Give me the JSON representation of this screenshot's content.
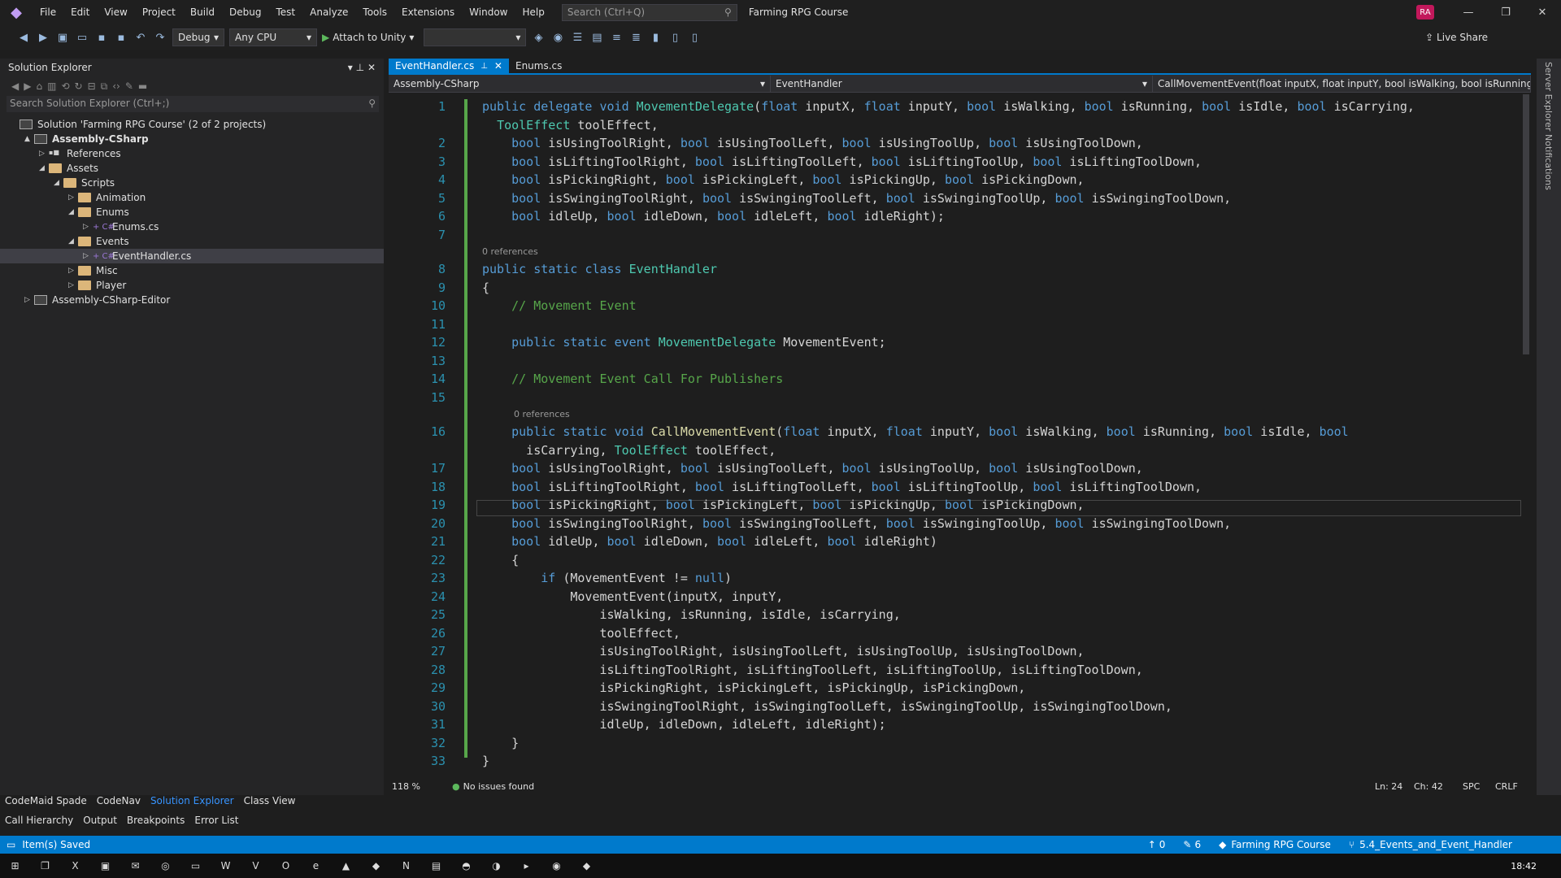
{
  "menubar": {
    "items": [
      "File",
      "Edit",
      "View",
      "Project",
      "Build",
      "Debug",
      "Test",
      "Analyze",
      "Tools",
      "Extensions",
      "Window",
      "Help"
    ],
    "search_placeholder": "Search (Ctrl+Q)",
    "solution_name": "Farming RPG Course",
    "avatar_initials": "RA"
  },
  "toolbar": {
    "config": "Debug",
    "platform": "Any CPU",
    "attach_label": "Attach to Unity",
    "live_share": "Live Share"
  },
  "solution_explorer": {
    "title": "Solution Explorer",
    "search_placeholder": "Search Solution Explorer (Ctrl+;)",
    "tree": [
      {
        "label": "Solution 'Farming RPG Course' (2 of 2 projects)",
        "level": 0,
        "kind": "solution",
        "arrow": ""
      },
      {
        "label": "Assembly-CSharp",
        "level": 1,
        "kind": "project",
        "arrow": "▲",
        "bold": true
      },
      {
        "label": "References",
        "level": 2,
        "kind": "refs",
        "arrow": "▷"
      },
      {
        "label": "Assets",
        "level": 2,
        "kind": "folder",
        "arrow": "◢"
      },
      {
        "label": "Scripts",
        "level": 3,
        "kind": "folder",
        "arrow": "◢"
      },
      {
        "label": "Animation",
        "level": 4,
        "kind": "folder",
        "arrow": "▷"
      },
      {
        "label": "Enums",
        "level": 4,
        "kind": "folder",
        "arrow": "◢"
      },
      {
        "label": "Enums.cs",
        "level": 5,
        "kind": "cs",
        "arrow": "▷"
      },
      {
        "label": "Events",
        "level": 4,
        "kind": "folder",
        "arrow": "◢"
      },
      {
        "label": "EventHandler.cs",
        "level": 5,
        "kind": "cs",
        "arrow": "▷",
        "selected": true
      },
      {
        "label": "Misc",
        "level": 4,
        "kind": "folder",
        "arrow": "▷"
      },
      {
        "label": "Player",
        "level": 4,
        "kind": "folder",
        "arrow": "▷"
      },
      {
        "label": "Assembly-CSharp-Editor",
        "level": 1,
        "kind": "project",
        "arrow": "▷"
      }
    ],
    "tabs": [
      "CodeMaid Spade",
      "CodeNav",
      "Solution Explorer",
      "Class View"
    ],
    "active_tab": "Solution Explorer"
  },
  "bottom_tabs": [
    "Call Hierarchy",
    "Output",
    "Breakpoints",
    "Error List"
  ],
  "editor": {
    "tabs": [
      {
        "label": "EventHandler.cs",
        "active": true
      },
      {
        "label": "Enums.cs",
        "active": false
      }
    ],
    "nav_project": "Assembly-CSharp",
    "nav_class": "EventHandler",
    "nav_member": "CallMovementEvent(float inputX, float inputY, bool isWalking, bool isRunning, bo",
    "references_label": "0 references",
    "zoom": "118 %",
    "issues": "No issues found",
    "line": "Ln: 24",
    "col": "Ch: 42",
    "spc": "SPC",
    "eol": "CRLF",
    "lines": [
      {
        "n": "1",
        "t": "public delegate void MovementDelegate(float inputX, float inputY, bool isWalking, bool isRunning, bool isIdle, bool isCarrying,"
      },
      {
        "n": "",
        "t": "  ToolEffect toolEffect,"
      },
      {
        "n": "2",
        "t": "    bool isUsingToolRight, bool isUsingToolLeft, bool isUsingToolUp, bool isUsingToolDown,"
      },
      {
        "n": "3",
        "t": "    bool isLiftingToolRight, bool isLiftingToolLeft, bool isLiftingToolUp, bool isLiftingToolDown,"
      },
      {
        "n": "4",
        "t": "    bool isPickingRight, bool isPickingLeft, bool isPickingUp, bool isPickingDown,"
      },
      {
        "n": "5",
        "t": "    bool isSwingingToolRight, bool isSwingingToolLeft, bool isSwingingToolUp, bool isSwingingToolDown,"
      },
      {
        "n": "6",
        "t": "    bool idleUp, bool idleDown, bool idleLeft, bool idleRight);"
      },
      {
        "n": "7",
        "t": ""
      },
      {
        "n": "8",
        "t": "public static class EventHandler"
      },
      {
        "n": "9",
        "t": "{"
      },
      {
        "n": "10",
        "t": "    // Movement Event"
      },
      {
        "n": "11",
        "t": ""
      },
      {
        "n": "12",
        "t": "    public static event MovementDelegate MovementEvent;"
      },
      {
        "n": "13",
        "t": ""
      },
      {
        "n": "14",
        "t": "    // Movement Event Call For Publishers"
      },
      {
        "n": "15",
        "t": ""
      },
      {
        "n": "16",
        "t": "    public static void CallMovementEvent(float inputX, float inputY, bool isWalking, bool isRunning, bool isIdle, bool"
      },
      {
        "n": "",
        "t": "      isCarrying, ToolEffect toolEffect,"
      },
      {
        "n": "17",
        "t": "    bool isUsingToolRight, bool isUsingToolLeft, bool isUsingToolUp, bool isUsingToolDown,"
      },
      {
        "n": "18",
        "t": "    bool isLiftingToolRight, bool isLiftingToolLeft, bool isLiftingToolUp, bool isLiftingToolDown,"
      },
      {
        "n": "19",
        "t": "    bool isPickingRight, bool isPickingLeft, bool isPickingUp, bool isPickingDown,"
      },
      {
        "n": "20",
        "t": "    bool isSwingingToolRight, bool isSwingingToolLeft, bool isSwingingToolUp, bool isSwingingToolDown,"
      },
      {
        "n": "21",
        "t": "    bool idleUp, bool idleDown, bool idleLeft, bool idleRight)"
      },
      {
        "n": "22",
        "t": "    {"
      },
      {
        "n": "23",
        "t": "        if (MovementEvent != null)"
      },
      {
        "n": "24",
        "t": "            MovementEvent(inputX, inputY,"
      },
      {
        "n": "25",
        "t": "                isWalking, isRunning, isIdle, isCarrying,"
      },
      {
        "n": "26",
        "t": "                toolEffect,"
      },
      {
        "n": "27",
        "t": "                isUsingToolRight, isUsingToolLeft, isUsingToolUp, isUsingToolDown,"
      },
      {
        "n": "28",
        "t": "                isLiftingToolRight, isLiftingToolLeft, isLiftingToolUp, isLiftingToolDown,"
      },
      {
        "n": "29",
        "t": "                isPickingRight, isPickingLeft, isPickingUp, isPickingDown,"
      },
      {
        "n": "30",
        "t": "                isSwingingToolRight, isSwingingToolLeft, isSwingingToolUp, isSwingingToolDown,"
      },
      {
        "n": "31",
        "t": "                idleUp, idleDown, idleLeft, idleRight);"
      },
      {
        "n": "32",
        "t": "    }"
      },
      {
        "n": "33",
        "t": "}"
      }
    ]
  },
  "right_rail": [
    "Server Explorer",
    "Notifications"
  ],
  "statusbar": {
    "message": "Item(s) Saved",
    "up_count": "0",
    "edit_count": "6",
    "repo": "Farming RPG Course",
    "branch": "5.4_Events_and_Event_Handler"
  },
  "taskbar": {
    "time": "18:42",
    "apps": [
      "start-icon",
      "task-view-icon",
      "excel-icon",
      "store-icon",
      "mail-icon",
      "chrome-icon",
      "explorer-icon",
      "word-icon",
      "visio-icon",
      "outlook-icon",
      "edge-icon",
      "photoshop-icon",
      "app-icon",
      "onenote-icon",
      "notes-icon",
      "unity-hub-icon",
      "unity-icon",
      "terminal-icon",
      "browser-icon",
      "visual-studio-icon"
    ]
  },
  "colors": {
    "accent": "#007acc",
    "keyword": "#569cd6",
    "type": "#4ec9b0",
    "method": "#dcdcaa",
    "comment": "#57a64a",
    "param": "#9cdcfe"
  }
}
